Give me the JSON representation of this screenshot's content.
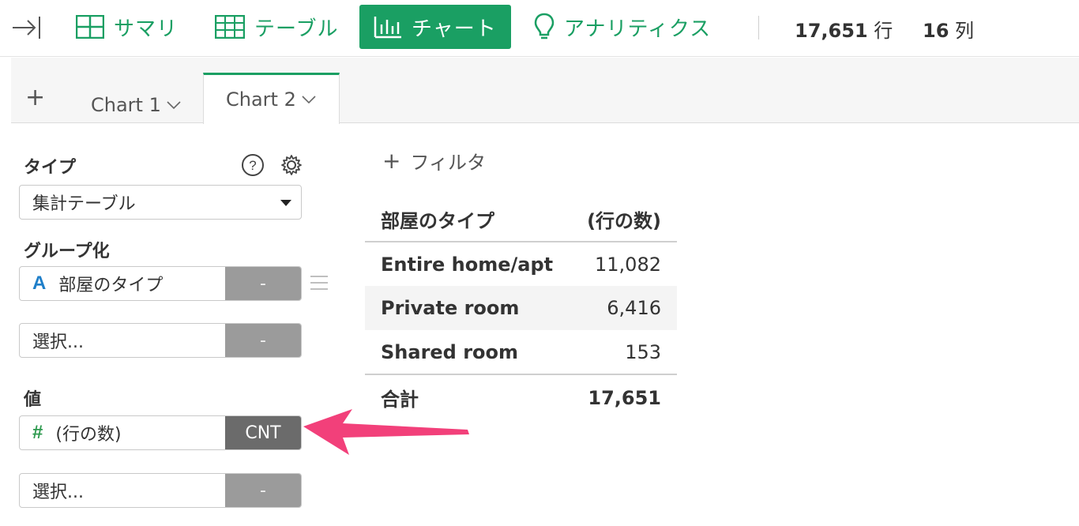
{
  "toolbar": {
    "summary": "サマリ",
    "table": "テーブル",
    "chart": "チャート",
    "analytics": "アナリティクス",
    "rows_value": "17,651",
    "rows_unit": "行",
    "cols_value": "16",
    "cols_unit": "列"
  },
  "tabs": {
    "add": "+",
    "items": [
      {
        "label": "Chart 1"
      },
      {
        "label": "Chart 2"
      }
    ]
  },
  "panel": {
    "type_label": "タイプ",
    "type_value": "集計テーブル",
    "group_label": "グループ化",
    "group_field": "部屋のタイプ",
    "group_field_type": "A",
    "group_agg": "-",
    "group_select": "選択...",
    "group_select_agg": "-",
    "value_label": "値",
    "value_field": "(行の数)",
    "value_field_type": "#",
    "value_agg": "CNT",
    "value_select": "選択...",
    "value_select_agg": "-"
  },
  "filter": {
    "plus": "+",
    "label": "フィルタ"
  },
  "result": {
    "headers": [
      "部屋のタイプ",
      "(行の数)"
    ],
    "rows": [
      {
        "label": "Entire home/apt",
        "value": "11,082"
      },
      {
        "label": "Private room",
        "value": "6,416"
      },
      {
        "label": "Shared room",
        "value": "153"
      }
    ],
    "total_label": "合計",
    "total_value": "17,651"
  },
  "colors": {
    "accent": "#1a9f63",
    "annotation_arrow": "#f2407a",
    "agg_gray": "#9b9b9b",
    "agg_dark": "#6b6b6b"
  }
}
